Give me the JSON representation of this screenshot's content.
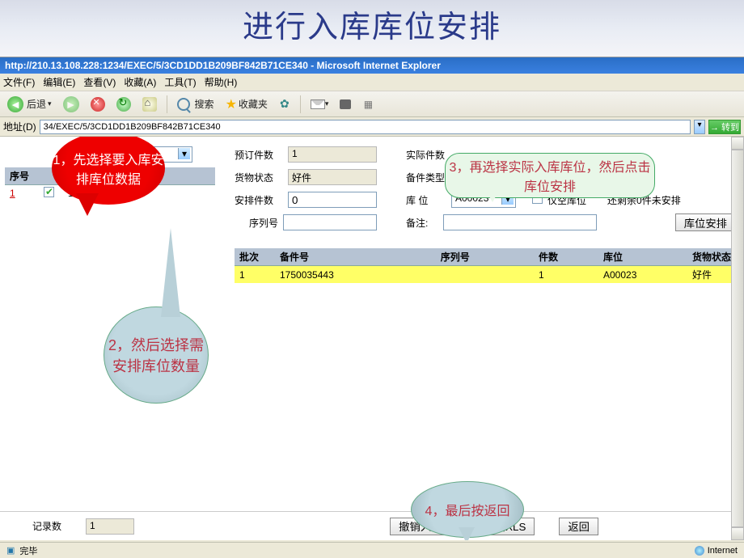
{
  "slide_title": "进行入库库位安排",
  "ie": {
    "title": "http://210.13.108.228:1234/EXEC/5/3CD1DD1B209BF842B71CE340 - Microsoft Internet Explorer",
    "menu": [
      "文件(F)",
      "编辑(E)",
      "查看(V)",
      "收藏(A)",
      "工具(T)",
      "帮助(H)"
    ],
    "back_label": "后退",
    "search_label": "搜索",
    "fav_label": "收藏夹",
    "addr_label": "地址(D)",
    "url": "34/EXEC/5/3CD1DD1B209BF842B71CE340",
    "go_label": "转到",
    "status_done": "完毕",
    "zone": "Internet"
  },
  "left": {
    "col_seq": "序号",
    "col_contract": "合同号",
    "row": {
      "seq": "1",
      "contract": "1750035443"
    }
  },
  "form": {
    "reserved_label": "预订件数",
    "reserved_value": "1",
    "actual_label": "实际件数",
    "status_label": "货物状态",
    "status_value": "好件",
    "spare_type_label": "备件类型",
    "arrange_qty_label": "安排件数",
    "arrange_qty_value": "0",
    "loc_label": "库 位",
    "loc_value": "A00023",
    "only_empty_label": "仅空库位",
    "remaining_text": "还剩余0件未安排",
    "serial_label": "序列号",
    "remark_label": "备注:",
    "arrange_btn": "库位安排"
  },
  "grid": {
    "headers": [
      "批次",
      "备件号",
      "序列号",
      "件数",
      "库位",
      "货物状态"
    ],
    "row": {
      "batch": "1",
      "spare_no": "1750035443",
      "serial": "",
      "qty": "1",
      "loc": "A00023",
      "status": "好件"
    }
  },
  "callouts": {
    "red": "1，先选择要入库安排库位数据",
    "blue1": "2，然后选择需安排库位数量",
    "green": "3，再选择实际入库库位，然后点击  库位安排",
    "blue2": "4，最后按返回"
  },
  "bottom": {
    "records_label": "记录数",
    "records_value": "1",
    "cancel_btn": "撤销入库",
    "export_btn": "导出XLS",
    "back_btn": "返回"
  }
}
